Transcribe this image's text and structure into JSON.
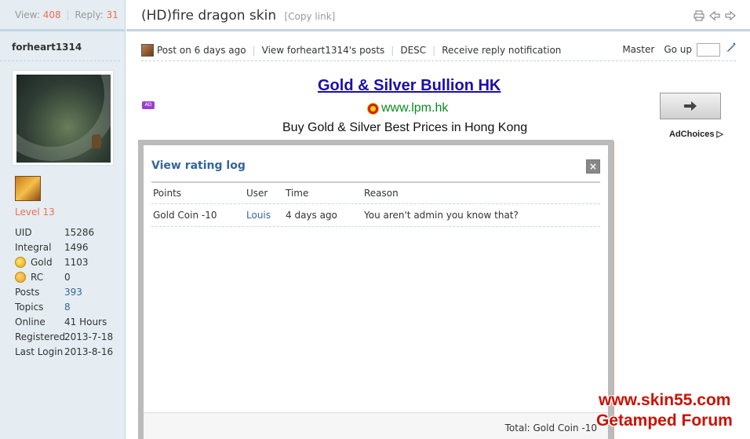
{
  "sidebar": {
    "views_label": "View:",
    "views": "408",
    "replies_label": "Reply:",
    "replies": "31",
    "username": "forheart1314",
    "level": "Level 13",
    "info": [
      {
        "key": "UID",
        "value": "15286",
        "icon": ""
      },
      {
        "key": "Integral",
        "value": "1496",
        "icon": ""
      },
      {
        "key": "Gold",
        "value": "1103",
        "icon": "gold-coin-icon"
      },
      {
        "key": "RC",
        "value": "0",
        "icon": "rc-coin-icon"
      },
      {
        "key": "Posts",
        "value": "393",
        "icon": ""
      },
      {
        "key": "Topics",
        "value": "8",
        "icon": ""
      },
      {
        "key": "Online",
        "value": "41 Hours",
        "icon": ""
      },
      {
        "key": "Registered",
        "value": "2013-7-18",
        "icon": ""
      },
      {
        "key": "Last Login",
        "value": "2013-8-16",
        "icon": ""
      }
    ]
  },
  "header": {
    "title": "(HD)fire dragon skin",
    "copy_link": "[Copy link]"
  },
  "post_toolbar": {
    "posted": "Post on 6 days ago",
    "view_posts": "View forheart1314's posts",
    "desc": "DESC",
    "notify": "Receive reply notification",
    "master": "Master",
    "go_up": "Go up"
  },
  "ad": {
    "badge": "AD",
    "title": "Gold & Silver Bullion HK",
    "url": "www.lpm.hk",
    "desc": "Buy Gold & Silver Best Prices in Hong Kong",
    "adchoices": "AdChoices"
  },
  "modal": {
    "title": "View rating log",
    "close": "×",
    "columns": [
      "Points",
      "User",
      "Time",
      "Reason"
    ],
    "rows": [
      {
        "points": "Gold Coin -10",
        "user": "Louis",
        "time": "4 days ago",
        "reason": "You aren't admin you know that?"
      }
    ],
    "total": "Total: Gold Coin -10"
  },
  "watermark": {
    "url": "www.skin55.com",
    "forum": "Getamped Forum"
  },
  "colors": {
    "accent": "#336699",
    "highlight": "#f26c4f",
    "sidebar_bg": "#e5edf2"
  }
}
